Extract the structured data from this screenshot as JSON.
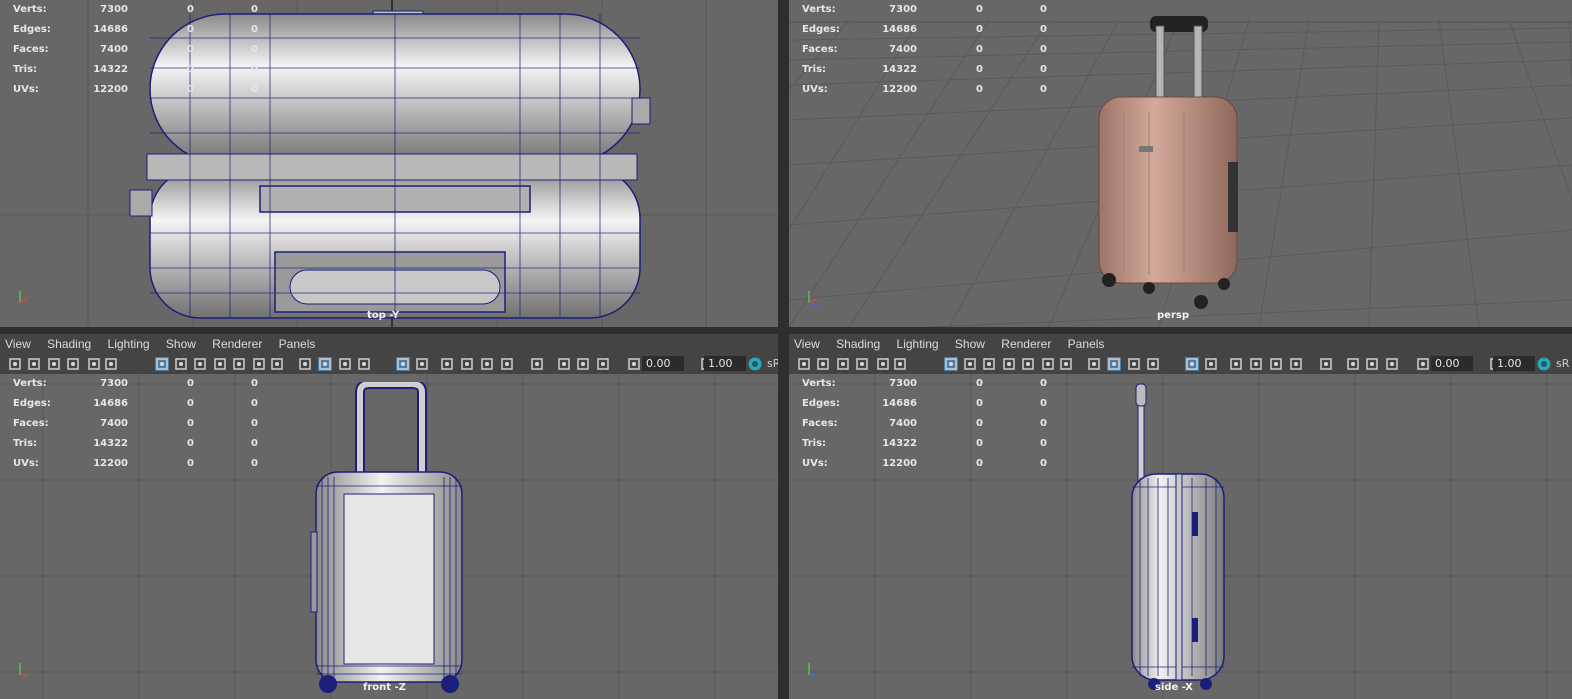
{
  "viewports": [
    {
      "id": "top",
      "label": "top -Y",
      "stats": {
        "verts": [
          "7300",
          "0",
          "0"
        ],
        "edges": [
          "14686",
          "0",
          "0"
        ],
        "faces": [
          "7400",
          "0",
          "0"
        ],
        "tris": [
          "14322",
          "0",
          "0"
        ],
        "uvs": [
          "12200",
          "0",
          "0"
        ]
      }
    },
    {
      "id": "persp",
      "label": "persp",
      "stats": {
        "verts": [
          "7300",
          "0",
          "0"
        ],
        "edges": [
          "14686",
          "0",
          "0"
        ],
        "faces": [
          "7400",
          "0",
          "0"
        ],
        "tris": [
          "14322",
          "0",
          "0"
        ],
        "uvs": [
          "12200",
          "0",
          "0"
        ]
      }
    },
    {
      "id": "front",
      "label": "front -Z",
      "stats": {
        "verts": [
          "7300",
          "0",
          "0"
        ],
        "edges": [
          "14686",
          "0",
          "0"
        ],
        "faces": [
          "7400",
          "0",
          "0"
        ],
        "tris": [
          "14322",
          "0",
          "0"
        ],
        "uvs": [
          "12200",
          "0",
          "0"
        ]
      }
    },
    {
      "id": "side",
      "label": "side -X",
      "stats": {
        "verts": [
          "7300",
          "0",
          "0"
        ],
        "edges": [
          "14686",
          "0",
          "0"
        ],
        "faces": [
          "7400",
          "0",
          "0"
        ],
        "tris": [
          "14322",
          "0",
          "0"
        ],
        "uvs": [
          "12200",
          "0",
          "0"
        ]
      }
    }
  ],
  "stat_labels": {
    "verts": "Verts:",
    "edges": "Edges:",
    "faces": "Faces:",
    "tris": "Tris:",
    "uvs": "UVs:"
  },
  "menu": {
    "view": "View",
    "shading": "Shading",
    "lighting": "Lighting",
    "show": "Show",
    "renderer": "Renderer",
    "panels": "Panels"
  },
  "toolbar": {
    "field1": "0.00",
    "field2": "1.00",
    "clipped_text": "sR"
  },
  "colors": {
    "viewport_bg": "#676767",
    "wire": "#1b1f7a",
    "suitcase": "#c49a8c"
  }
}
